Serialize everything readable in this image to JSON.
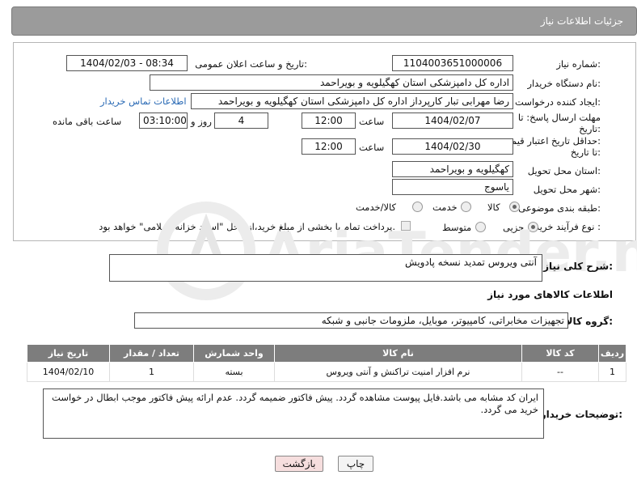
{
  "header": {
    "title": "جزئیات اطلاعات نیاز"
  },
  "form": {
    "need_number_label": "شماره نیاز:",
    "need_number": "1104003651000006",
    "announce_label": "تاریخ و ساعت اعلان عمومی:",
    "announce_value": "1404/02/03 - 08:34",
    "buyer_org_label": "نام دستگاه خریدار:",
    "buyer_org": "اداره کل دامپزشکی استان کهگیلویه و بویراحمد",
    "creator_label": "ایجاد کننده درخواست:",
    "creator": "رضا مهرابی تبار کارپرداز اداره کل دامپزشکی استان کهگیلویه و بویراحمد",
    "contact_link": "اطلاعات تماس خریدار",
    "deadline_label_1": "مهلت ارسال پاسخ: تا",
    "deadline_label_2": "تاریخ:",
    "deadline_date": "1404/02/07",
    "time_label": "ساعت",
    "deadline_time": "12:00",
    "days_value": "4",
    "days_label": "روز و",
    "remaining_value": "03:10:00",
    "remaining_label": "ساعت باقی مانده",
    "validity_label_1": "حداقل تاریخ اعتبار قیمت:",
    "validity_label_2": "تا تاریخ:",
    "validity_date": "1404/02/30",
    "validity_time": "12:00",
    "province_label": "استان محل تحویل:",
    "province": "کهگیلویه و بویراحمد",
    "city_label": "شهر محل تحویل:",
    "city": "یاسوج",
    "category_label": "طبقه بندی موضوعی:",
    "category_options": [
      "کالا",
      "خدمت",
      "کالا/خدمت"
    ],
    "category_selected": "کالا",
    "process_label": "نوع فرآیند خرید :",
    "process_options": [
      "جزیی",
      "متوسط"
    ],
    "process_selected": "جزیی",
    "payment_note": "پرداخت تمام یا بخشی از مبلغ خرید،از محل \"اسناد خزانه اسلامی\" خواهد بود."
  },
  "description": {
    "label": "شرح کلی نیاز:",
    "value": "آنتی ویروس تمدید نسخه پادویش"
  },
  "goods": {
    "section_title": "اطلاعات کالاهای مورد نیاز",
    "group_label": "گروه کالا:",
    "group_value": "تجهیزات مخابراتی، کامپیوتر، موبایل، ملزومات جانبی و شبکه",
    "columns": [
      "ردیف",
      "کد کالا",
      "نام کالا",
      "واحد شمارش",
      "تعداد / مقدار",
      "تاریخ نیاز"
    ],
    "rows": [
      [
        "1",
        "--",
        "نرم افزار امنیت تراکنش و آنتی ویروس",
        "بسته",
        "1",
        "1404/02/10"
      ]
    ]
  },
  "notes": {
    "label": "توضیحات خریدار:",
    "value": "ایران کد مشابه می باشد.فایل پیوست مشاهده گردد. پیش فاکتور ضمیمه گردد. عدم ارائه پیش فاکتور موجب ابطال در خواست خرید می گردد."
  },
  "buttons": {
    "print": "چاپ",
    "back": "بازگشت"
  },
  "watermark_text": "AriaTender.neT",
  "colors": {
    "header_bg": "#9b9b9b",
    "table_header_bg": "#7d7d7d",
    "link": "#2a6ab5",
    "back_button_bg": "#f6dede"
  }
}
